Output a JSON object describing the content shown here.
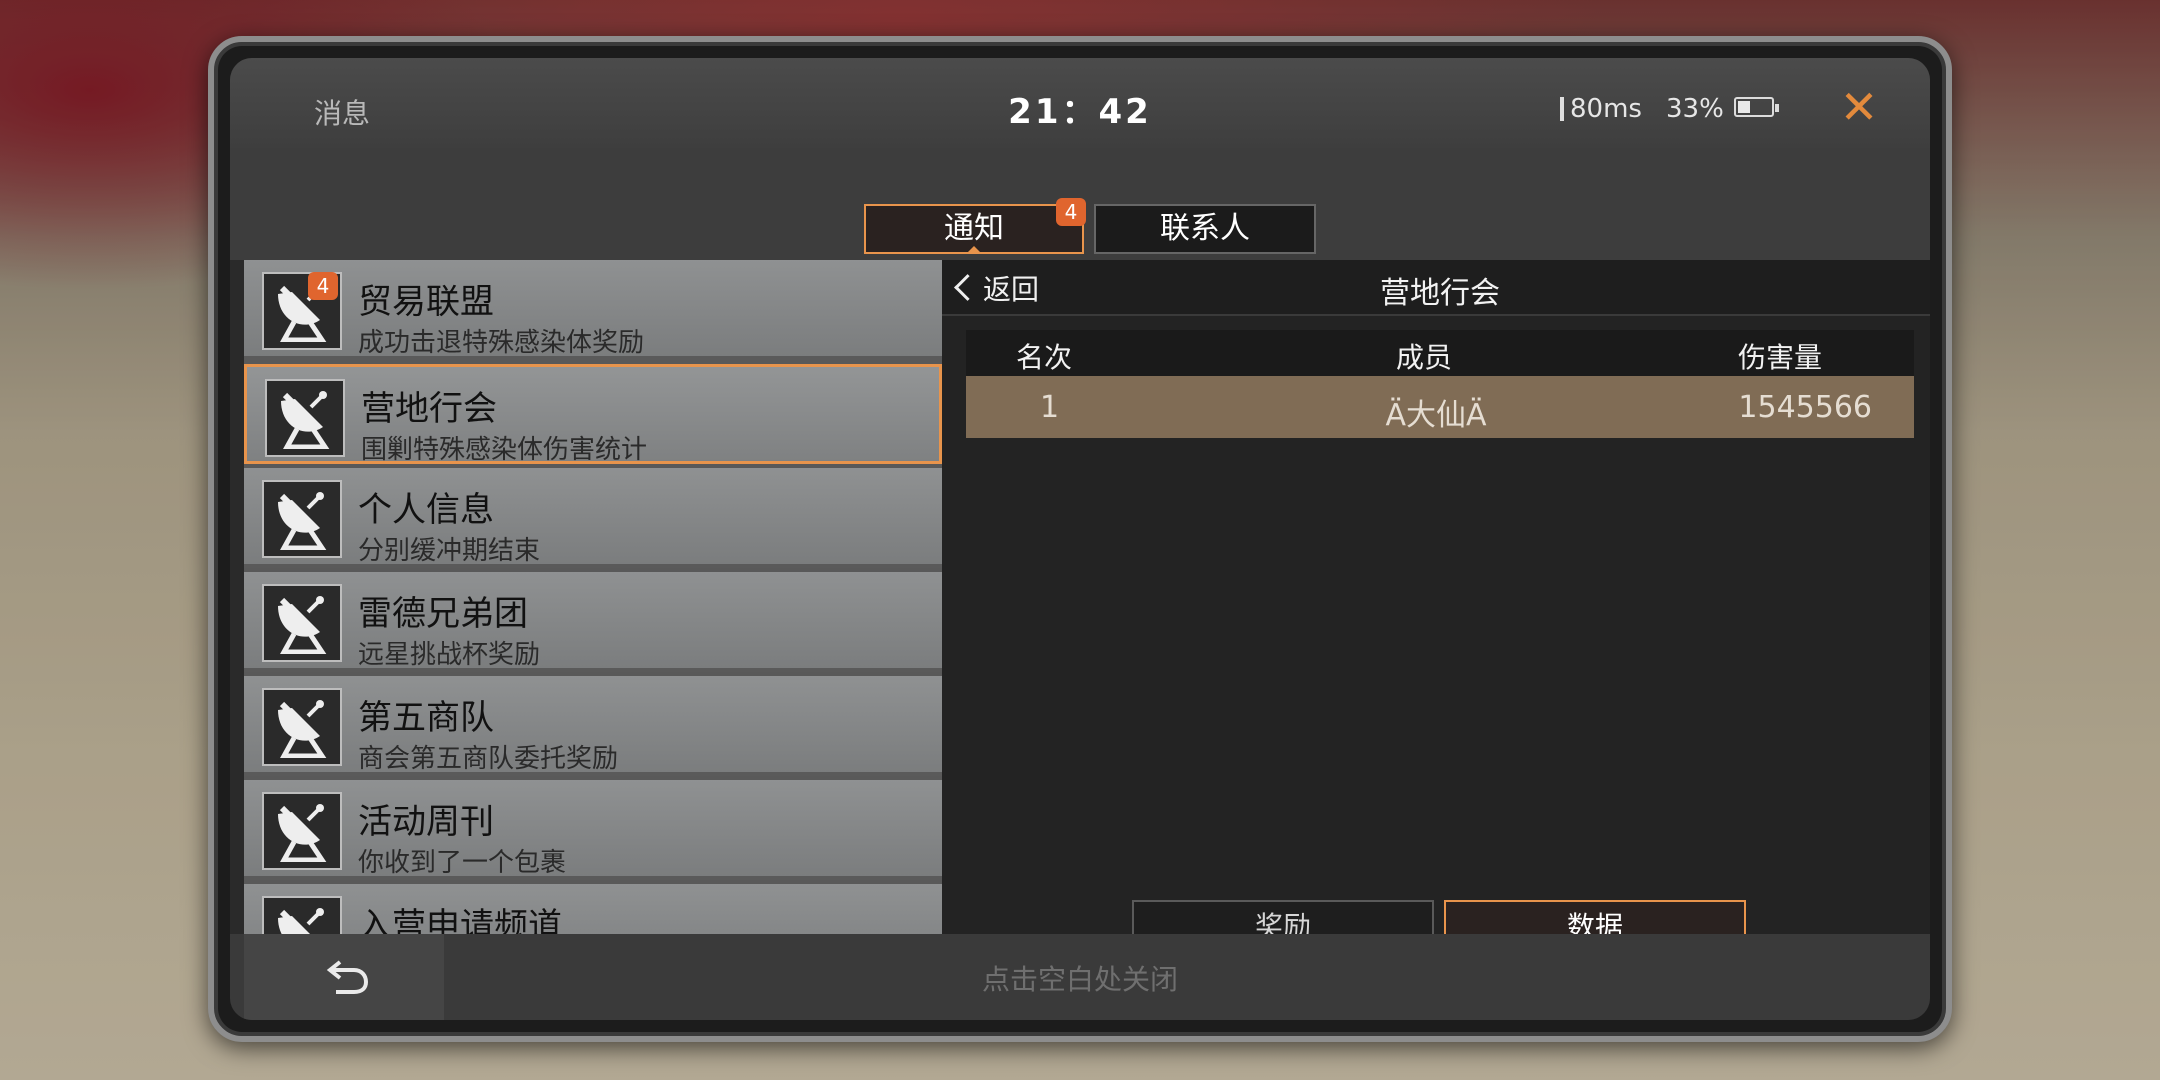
{
  "status": {
    "title": "消息",
    "time": "21：42",
    "ping": "80ms",
    "battery": "33%"
  },
  "tabs": [
    {
      "label": "通知",
      "badge": "4"
    },
    {
      "label": "联系人"
    }
  ],
  "list": [
    {
      "title": "贸易联盟",
      "subtitle": "成功击退特殊感染体奖励",
      "badge": "4"
    },
    {
      "title": "营地行会",
      "subtitle": "围剿特殊感染体伤害统计"
    },
    {
      "title": "个人信息",
      "subtitle": "分别缓冲期结束"
    },
    {
      "title": "雷德兄弟团",
      "subtitle": "远星挑战杯奖励"
    },
    {
      "title": "第五商队",
      "subtitle": "商会第五商队委托奖励"
    },
    {
      "title": "活动周刊",
      "subtitle": "你收到了一个包裹"
    },
    {
      "title": "入营申请频道",
      "subtitle": ""
    }
  ],
  "panel": {
    "back_label": "返回",
    "title": "营地行会",
    "columns": [
      "名次",
      "成员",
      "伤害量"
    ],
    "rows": [
      {
        "rank": "1",
        "member": "Ä大仙Ä",
        "damage": "1545566"
      }
    ],
    "buttons": {
      "reward": "奖励",
      "data": "数据"
    }
  },
  "footer": {
    "hint": "点击空白处关闭"
  },
  "colors": {
    "accent": "#e8944c",
    "badge": "#e0652e",
    "row_highlight": "#806c55"
  }
}
